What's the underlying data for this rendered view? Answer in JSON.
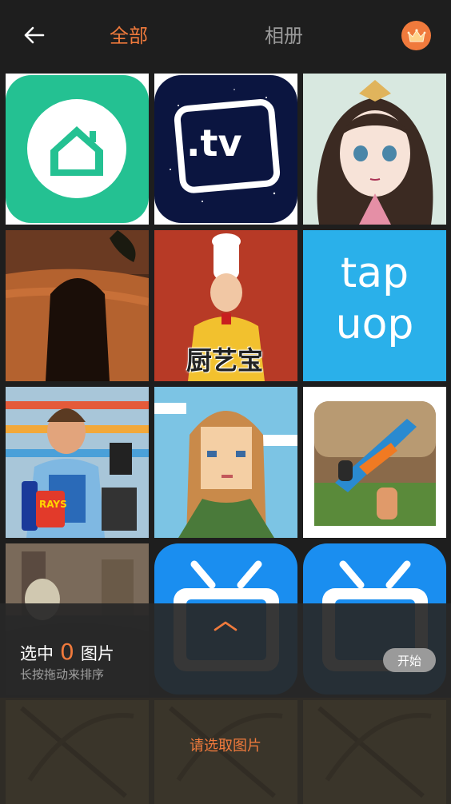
{
  "header": {
    "tab_all": "全部",
    "tab_album": "相册",
    "back_icon": "back-arrow-icon",
    "vip_icon": "crown-icon"
  },
  "grid": {
    "tiles": [
      {
        "name": "home-app-icon",
        "text": ""
      },
      {
        "name": "tv-app-icon",
        "text": ".tv"
      },
      {
        "name": "anime-girl-game-icon",
        "text": ""
      },
      {
        "name": "desert-silhouette-game-icon",
        "text": ""
      },
      {
        "name": "chef-app-icon",
        "text": "厨艺宝"
      },
      {
        "name": "taptap-app-icon",
        "text": "tap uop"
      },
      {
        "name": "cashier-game-icon",
        "text": "RAYS"
      },
      {
        "name": "pixel-girl-game-icon",
        "text": ""
      },
      {
        "name": "gun-shooter-game-icon",
        "text": ""
      },
      {
        "name": "warzone-game-icon",
        "text": ""
      },
      {
        "name": "tv-player-app-icon",
        "text": ""
      },
      {
        "name": "tv-player-app-icon-2",
        "text": ""
      },
      {
        "name": "bow-game-icon",
        "text": ""
      },
      {
        "name": "bow-game-icon-2",
        "text": ""
      },
      {
        "name": "bow-game-icon-3",
        "text": ""
      }
    ]
  },
  "panel": {
    "selected_prefix": "选中",
    "selected_count": "0",
    "selected_suffix": "图片",
    "hint": "长按拖动来排序",
    "start_label": "开始",
    "prompt": "请选取图片"
  },
  "colors": {
    "accent": "#f07a3c",
    "background": "#1e1e1e"
  }
}
